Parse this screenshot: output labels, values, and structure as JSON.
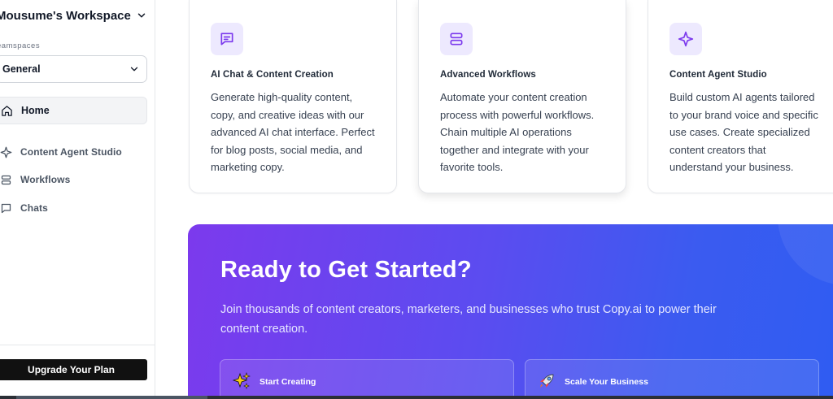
{
  "workspace": {
    "title": "Mousume's Workspace",
    "teamspaces_label": "eamspaces",
    "selected_teamspace": "General"
  },
  "nav": {
    "home": "Home",
    "items": [
      {
        "label": "Content Agent Studio",
        "icon": "sparkle-icon"
      },
      {
        "label": "Workflows",
        "icon": "workflow-icon"
      },
      {
        "label": "Chats",
        "icon": "chat-icon"
      }
    ]
  },
  "upgrade_label": "Upgrade Your Plan",
  "features": [
    {
      "title": "AI Chat & Content Creation",
      "icon": "chat-icon",
      "description": "Generate high-quality content, copy, and creative ideas with our advanced AI chat interface. Perfect for blog posts, social media, and marketing copy."
    },
    {
      "title": "Advanced Workflows",
      "icon": "workflow-icon",
      "description": "Automate your content creation process with powerful workflows. Chain multiple AI operations together and integrate with your favorite tools."
    },
    {
      "title": "Content Agent Studio",
      "icon": "sparkle-icon",
      "description": "Build custom AI agents tailored to your brand voice and specific use cases. Create specialized content creators that understand your business."
    }
  ],
  "hero": {
    "title": "Ready to Get Started?",
    "subtitle": "Join thousands of content creators, marketers, and businesses who trust Copy.ai to power their content creation.",
    "actions": [
      {
        "label": "Start Creating",
        "icon": "sparkles-emoji-icon"
      },
      {
        "label": "Scale Your Business",
        "icon": "rocket-icon"
      }
    ]
  },
  "colors": {
    "accent": "#7c3aed",
    "icon_bg": "#ede9fe",
    "hero_start": "#7c3aed",
    "hero_end": "#2f5cf2"
  }
}
